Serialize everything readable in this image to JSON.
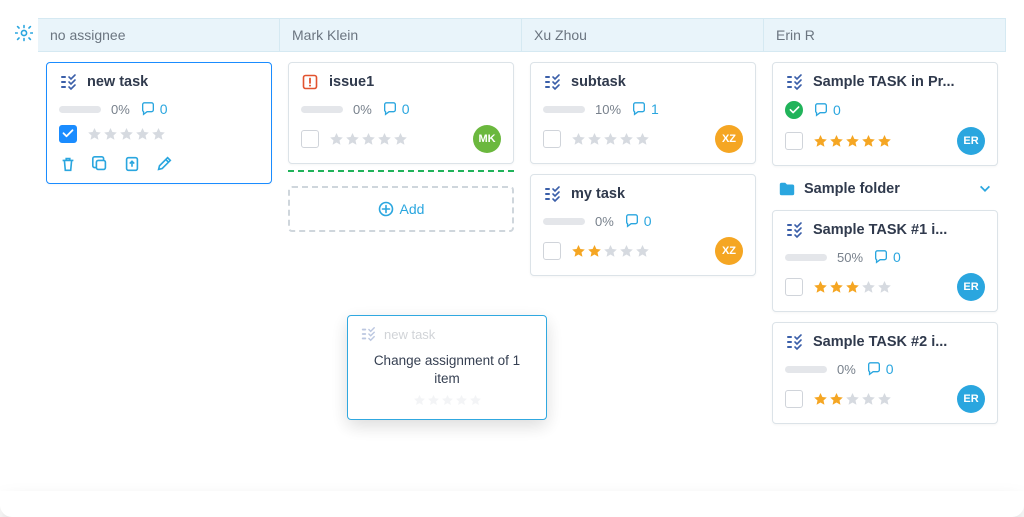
{
  "columns": [
    {
      "id": "no-assignee",
      "title": "no assignee"
    },
    {
      "id": "mark-klein",
      "title": "Mark Klein"
    },
    {
      "id": "xu-zhou",
      "title": "Xu Zhou"
    },
    {
      "id": "erin-r",
      "title": "Erin R"
    }
  ],
  "avatars": {
    "mk": {
      "initials": "MK",
      "color": "#6bb83e"
    },
    "xz": {
      "initials": "XZ",
      "color": "#f5a623"
    },
    "er": {
      "initials": "ER",
      "color": "#2aa6df"
    }
  },
  "add_button_label": "Add",
  "folder": {
    "name": "Sample folder"
  },
  "cards": {
    "c0_newtask": {
      "title": "new task",
      "progress": 0,
      "percent_label": "0%",
      "comments": 0,
      "stars": 0,
      "selected": true,
      "icon": "task"
    },
    "c1_issue1": {
      "title": "issue1",
      "progress": 0,
      "percent_label": "0%",
      "comments": 0,
      "stars": 0,
      "icon": "issue"
    },
    "c2_subtask": {
      "title": "subtask",
      "progress": 10,
      "percent_label": "10%",
      "comments": 1,
      "stars": 0,
      "icon": "task"
    },
    "c2_mytask": {
      "title": "my task",
      "progress": 0,
      "percent_label": "0%",
      "comments": 0,
      "stars": 2,
      "icon": "task"
    },
    "c3_pr": {
      "title": "Sample TASK in Pr...",
      "comments": 0,
      "stars": 5,
      "done": true,
      "icon": "task"
    },
    "c3_t1": {
      "title": "Sample TASK #1 i...",
      "progress": 50,
      "percent_label": "50%",
      "comments": 0,
      "stars": 3,
      "icon": "task"
    },
    "c3_t2": {
      "title": "Sample TASK #2 i...",
      "progress": 0,
      "percent_label": "0%",
      "comments": 0,
      "stars": 2,
      "icon": "task"
    }
  },
  "ghost": {
    "title": "new task",
    "message": "Change assignment of 1 item"
  },
  "colors": {
    "accent": "#2aa6df",
    "taskIcon": "#3b5fa9",
    "issueIcon": "#e2532f"
  }
}
